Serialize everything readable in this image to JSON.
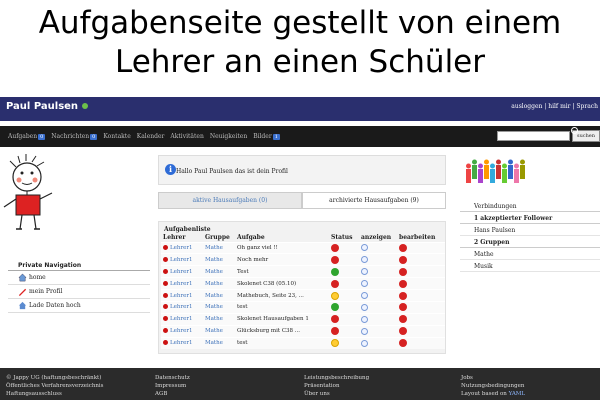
{
  "caption": {
    "line1": "Aufgabenseite gestellt von einem",
    "line2": "Lehrer an einen Schüler"
  },
  "header": {
    "brand": "Paul Paulsen",
    "links": "ausloggen | hilf mir | Sprach"
  },
  "nav": {
    "items": [
      {
        "label": "Aufgaben",
        "badge": "0"
      },
      {
        "label": "Nachrichten",
        "badge": "0"
      },
      {
        "label": "Kontakte",
        "badge": ""
      },
      {
        "label": "Kalender",
        "badge": ""
      },
      {
        "label": "Aktivitäten",
        "badge": ""
      },
      {
        "label": "Neuigkeiten",
        "badge": ""
      },
      {
        "label": "Bilder",
        "badge": "1"
      }
    ],
    "search_button": "suchen"
  },
  "profile_msg": "Hallo Paul Paulsen das ist dein Profil",
  "tabs": {
    "active": "aktive Hausaufgaben (0)",
    "archived": "archivierte Hausaufgaben (9)"
  },
  "tasks": {
    "title": "Aufgabenliste",
    "headers": [
      "Lehrer",
      "Gruppe",
      "Aufgabe",
      "Status",
      "anzeigen",
      "bearbeiten"
    ],
    "rows": [
      {
        "teacher": "Lehrer1",
        "group": "Mathe",
        "task": "Oh ganz viel !!",
        "status": "red"
      },
      {
        "teacher": "Lehrer1",
        "group": "Mathe",
        "task": "Noch mehr",
        "status": "red"
      },
      {
        "teacher": "Lehrer1",
        "group": "Mathe",
        "task": "Test",
        "status": "green"
      },
      {
        "teacher": "Lehrer1",
        "group": "Mathe",
        "task": "Skolenet C38 (05.10)",
        "status": "red"
      },
      {
        "teacher": "Lehrer1",
        "group": "Mathe",
        "task": "Mathebuch, Seite 23, ...",
        "status": "orange"
      },
      {
        "teacher": "Lehrer1",
        "group": "Mathe",
        "task": "test",
        "status": "green"
      },
      {
        "teacher": "Lehrer1",
        "group": "Mathe",
        "task": "Skolenet Hausaufgaben 1",
        "status": "red"
      },
      {
        "teacher": "Lehrer1",
        "group": "Mathe",
        "task": "Glücksburg mit C38 ...",
        "status": "red"
      },
      {
        "teacher": "Lehrer1",
        "group": "Mathe",
        "task": "test",
        "status": "orange"
      }
    ]
  },
  "private_nav": {
    "title": "Private Navigation",
    "items": [
      "home",
      "mein Profil",
      "Lade Daten hoch"
    ]
  },
  "connections": {
    "title": "Verbindungen",
    "followers": "1 akzeptierter Follower",
    "follower_name": "Hans Paulsen",
    "groups": "2 Gruppen",
    "group_items": [
      "Mathe",
      "Musik"
    ]
  },
  "footer": {
    "col1": [
      "© Jappy UG (haftungsbeschränkt)",
      "Öffentliches Verfahrensverzeichnis",
      "Haftungsausschluss"
    ],
    "col2": [
      "Datenschutz",
      "Impressum",
      "AGB"
    ],
    "col3": [
      "Leistungsbeschreibung",
      "Präsentation",
      "Über uns"
    ],
    "col4": [
      "Jobs",
      "Nutzungsbedingungen",
      "Layout based on"
    ],
    "col4_link": "YAML"
  }
}
